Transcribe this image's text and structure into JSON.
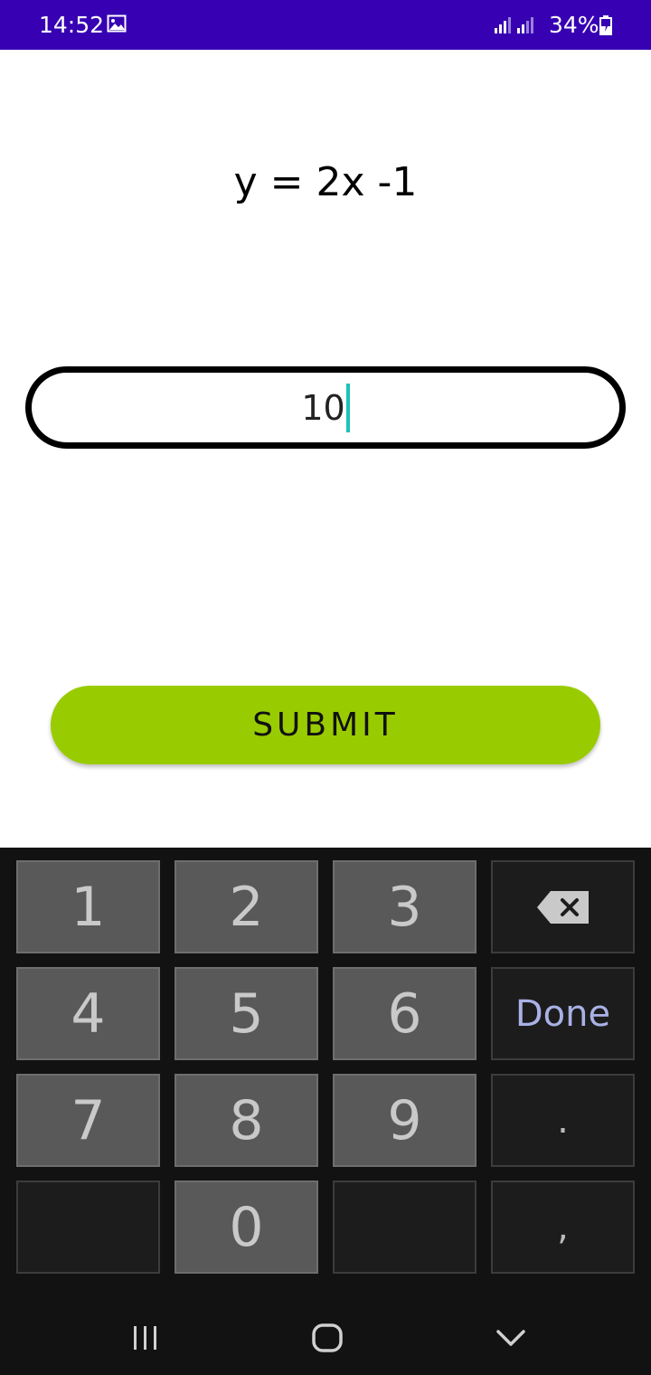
{
  "status_bar": {
    "time": "14:52",
    "battery": "34%"
  },
  "equation": "y = 2x -1",
  "answer_input": {
    "value": "10"
  },
  "submit_label": "SUBMIT",
  "keyboard": {
    "keys": [
      "1",
      "2",
      "3",
      "4",
      "5",
      "6",
      "7",
      "8",
      "9",
      "0"
    ],
    "done_label": "Done",
    "dot": ".",
    "comma": ","
  },
  "icons": {
    "gallery": "image-icon",
    "signal": "signal-icon",
    "battery": "battery-charging-icon",
    "backspace": "backspace-icon",
    "nav_recents": "recent-apps-icon",
    "nav_home": "home-icon",
    "nav_back": "back-chevron-icon"
  },
  "colors": {
    "status_bar": "#3700b3",
    "submit_button": "#99cc00",
    "caret": "#1cc3b8",
    "done_text": "#a9b1e6"
  }
}
